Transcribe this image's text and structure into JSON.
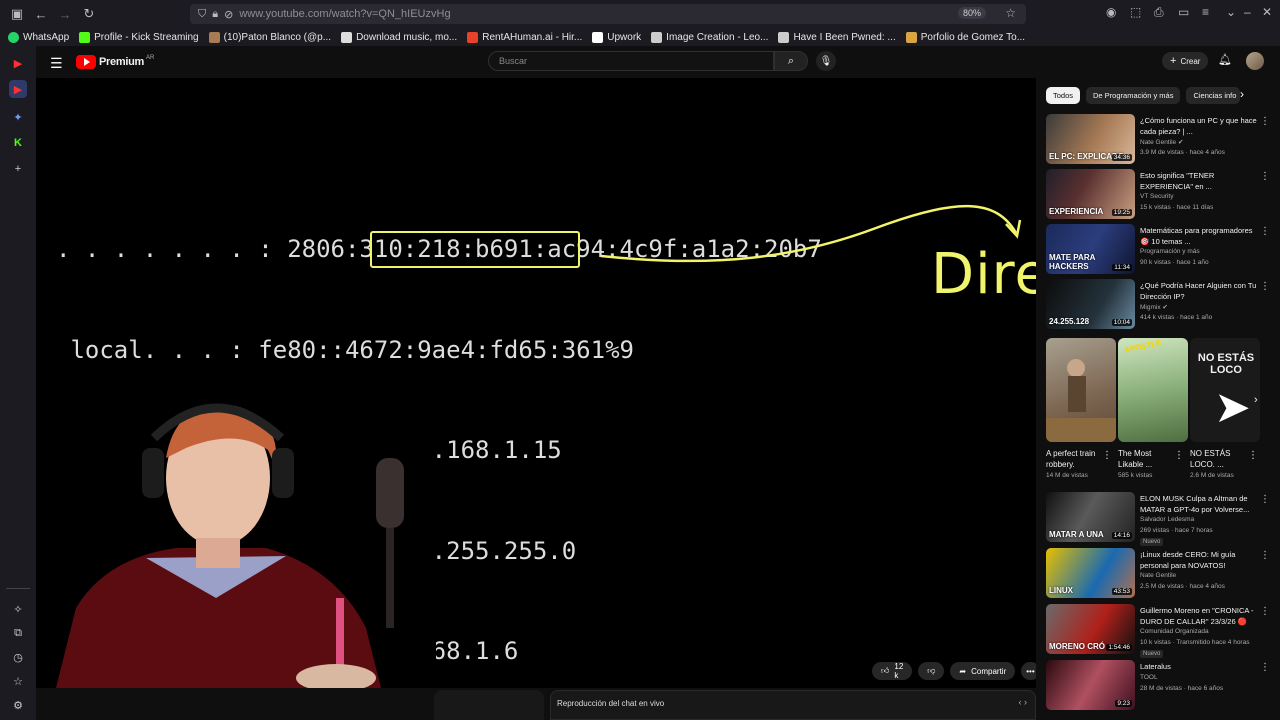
{
  "browser": {
    "url": "www.youtube.com/watch?v=QN_hIEUzvHg",
    "zoom": "80%"
  },
  "bookmarks": [
    {
      "label": "WhatsApp",
      "icon": "whatsapp-icon",
      "color": "#25d366"
    },
    {
      "label": "Profile - Kick Streaming",
      "icon": "kick-icon",
      "color": "#53fc18"
    },
    {
      "label": "(10)Paton Blanco (@p...",
      "icon": "avatar-icon",
      "color": "#a67c52"
    },
    {
      "label": "Download music, mo...",
      "icon": "download-icon",
      "color": "#dddddd"
    },
    {
      "label": "RentAHuman.ai - Hir...",
      "icon": "rentahuman-icon",
      "color": "#e8432a"
    },
    {
      "label": "Upwork",
      "icon": "upwork-icon",
      "color": "#ffffff"
    },
    {
      "label": "Image Creation - Leo...",
      "icon": "globe-icon",
      "color": "#cccccc"
    },
    {
      "label": "Have I Been Pwned: ...",
      "icon": "hibp-icon",
      "color": "#cccccc"
    },
    {
      "label": "Porfolio de Gomez To...",
      "icon": "portfolio-icon",
      "color": "#d9a441"
    }
  ],
  "youtube": {
    "logo_text": "Premium",
    "logo_country": "AR",
    "search_placeholder": "Buscar",
    "create_label": "Crear"
  },
  "video": {
    "terminal_lines": [
      ". . . . . . . : 2806:310:218:b691:ac94:4c9f:a1a2:20b7",
      " local. . . : fe80::4672:9ae4:fd65:361%9",
      " . . . . . . . . . . : 192.168.1.15",
      " . . . . . . . . . . : 255.255.255.0",
      "erminada . . . . . : 192.168.1.6"
    ],
    "handwritten": "Dire",
    "like_count": "12 k",
    "share_label": "Compartir"
  },
  "chat": {
    "title": "Reproducción del chat en vivo"
  },
  "chips": [
    "Todos",
    "De Programación y más",
    "Ciencias info"
  ],
  "recommendations": [
    {
      "title": "¿Cómo funciona un PC y que hace cada pieza? | ...",
      "channel": "Nate Gentile",
      "meta": "3.9 M de vistas · hace 4 años",
      "duration": "34:36",
      "thumb_text": "EL PC: EXPLICADO",
      "verified": true
    },
    {
      "title": "Esto significa \"TENER EXPERIENCIA\" en ...",
      "channel": "VT Security",
      "meta": "15 k vistas · hace 11 días",
      "duration": "19:25",
      "thumb_text": "EXPERIENCIA",
      "verified": false
    },
    {
      "title": "Matemáticas para programadores 🎯 10 temas ...",
      "channel": "Programación y más",
      "meta": "90 k vistas · hace 1 año",
      "duration": "11:34",
      "thumb_text": "MATE PARA HACKERS",
      "verified": false
    },
    {
      "title": "¿Qué Podría Hacer Alguien con Tu Dirección IP?",
      "channel": "Migmix",
      "meta": "414 k vistas · hace 1 año",
      "duration": "10:04",
      "thumb_text": "24.255.128",
      "verified": true
    }
  ],
  "shorts": [
    {
      "title": "A perfect train robbery.",
      "views": "14 M de vistas"
    },
    {
      "title": "The Most Likable ...",
      "views": "585 k vistas"
    },
    {
      "title": "NO ESTÁS LOCO. ...",
      "views": "2.6 M de vistas",
      "thumb_text": "NO ESTÁS LOCO"
    }
  ],
  "recommendations2": [
    {
      "title": "ELON MUSK Culpa a Altman de MATAR a GPT-4o por Volverse...",
      "channel": "Salvador Ledesma",
      "meta": "269 vistas · hace 7 horas",
      "duration": "14:16",
      "thumb_text": "MATAR A UNA",
      "badge": "Nuevo"
    },
    {
      "title": "¡Linux desde CERO: Mi guía personal para NOVATOS!",
      "channel": "Nate Gentile",
      "meta": "2.5 M de vistas · hace 4 años",
      "duration": "43:53",
      "thumb_text": "LINUX",
      "badge": ""
    },
    {
      "title": "Guillermo Moreno en \"CRONICA - DURO DE CALLAR\" 23/3/26 🔴",
      "channel": "Comunidad Organizada",
      "meta": "10 k vistas · Transmitido hace 4 horas",
      "duration": "1:54:46",
      "thumb_text": "MORENO CRÓ",
      "badge": "Nuevo"
    },
    {
      "title": "Lateralus",
      "channel": "TOOL",
      "meta": "28 M de vistas · hace 6 años",
      "duration": "9:23",
      "thumb_text": "",
      "badge": ""
    }
  ]
}
